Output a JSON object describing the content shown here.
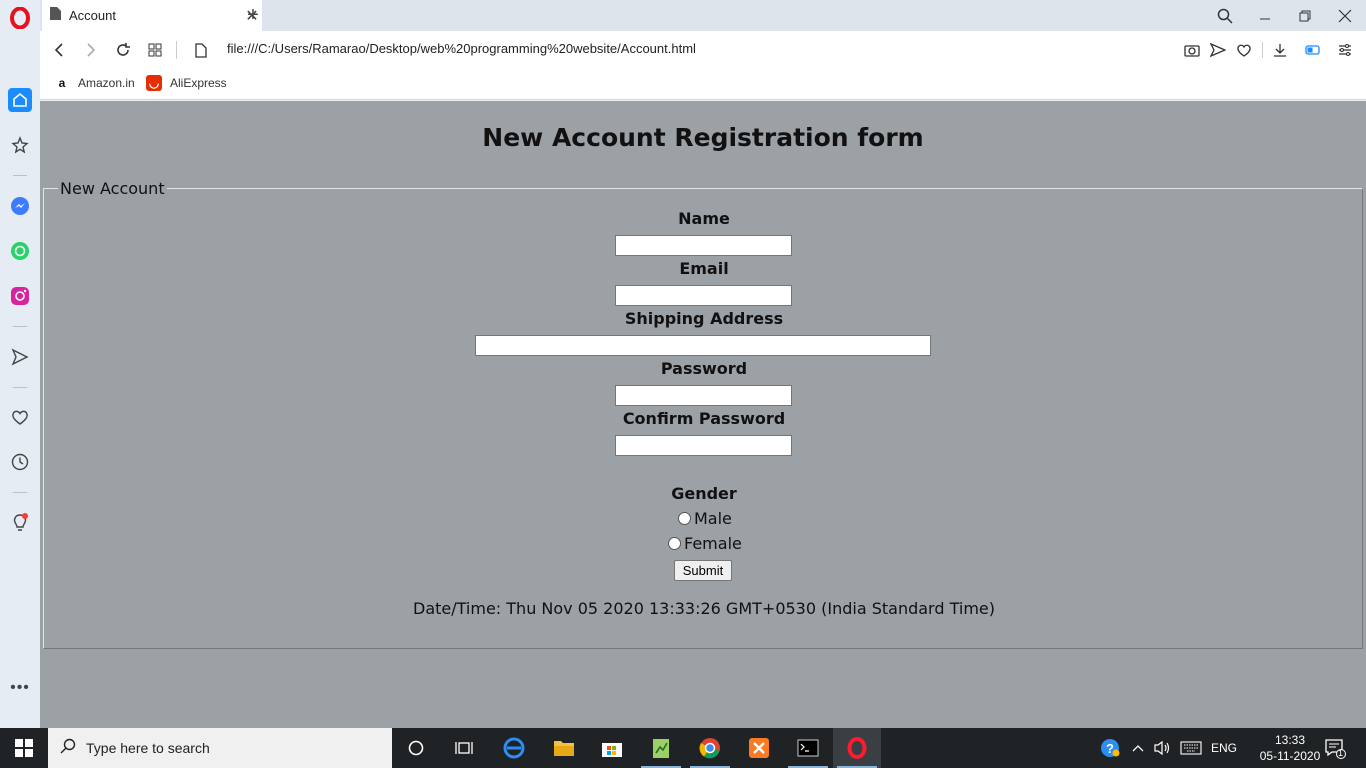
{
  "browser": {
    "tab_title": "Account",
    "url": "file:///C:/Users/Ramarao/Desktop/web%20programming%20website/Account.html",
    "bookmarks": [
      {
        "label": "Amazon.in",
        "icon": "amazon-icon"
      },
      {
        "label": "AliExpress",
        "icon": "aliexpress-icon"
      }
    ],
    "sidebar_icons": [
      "opera-logo-icon",
      "home-icon",
      "star-icon",
      "messenger-icon",
      "whatsapp-icon",
      "instagram-icon",
      "send-icon",
      "heart-icon",
      "history-icon",
      "bulb-icon",
      "more-icon"
    ],
    "colors": {
      "accent": "#1a8cff",
      "opera_red": "#ff1b2d",
      "page_bg": "#9ca1a5"
    }
  },
  "page": {
    "title": "New Account Registration form",
    "legend": "New Account",
    "fields": {
      "name_label": "Name",
      "email_label": "Email",
      "address_label": "Shipping Address",
      "password_label": "Password",
      "confirm_label": "Confirm Password",
      "gender_label": "Gender",
      "male_label": "Male",
      "female_label": "Female"
    },
    "submit_label": "Submit",
    "datetime": "Date/Time: Thu Nov 05 2020 13:33:26 GMT+0530 (India Standard Time)"
  },
  "taskbar": {
    "search_placeholder": "Type here to search",
    "language": "ENG",
    "time": "13:33",
    "date": "05-11-2020",
    "notification_count": "1"
  }
}
